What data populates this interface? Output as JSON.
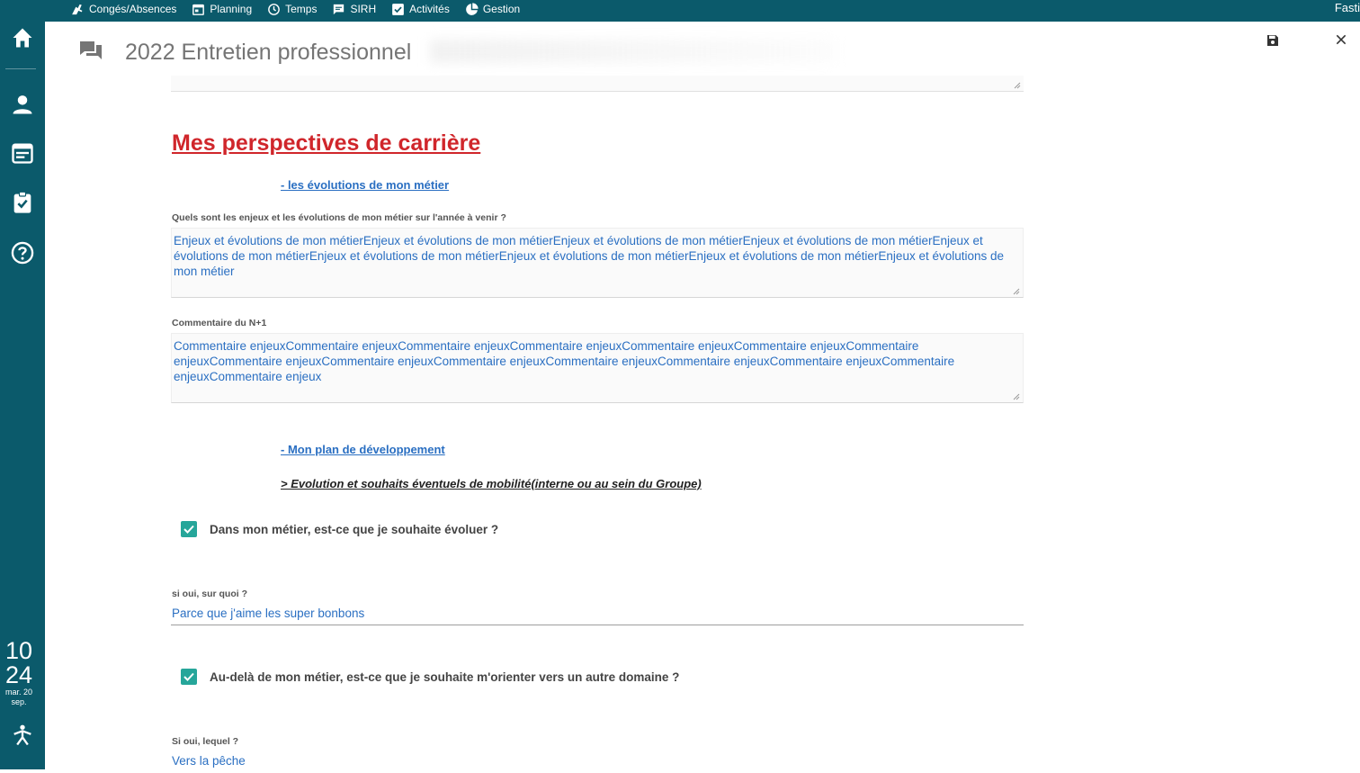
{
  "topnav": {
    "items": [
      {
        "label": "Congés/Absences",
        "icon": "plane-person-icon"
      },
      {
        "label": "Planning",
        "icon": "calendar-icon"
      },
      {
        "label": "Temps",
        "icon": "clock-icon"
      },
      {
        "label": "SIRH",
        "icon": "chat-icon"
      },
      {
        "label": "Activités",
        "icon": "checkbox-icon"
      },
      {
        "label": "Gestion",
        "icon": "pie-chart-icon"
      }
    ],
    "right_text": "Fasti"
  },
  "sidebar": {
    "icons": [
      "home-icon",
      "person-icon",
      "calendar-icon",
      "clipboard-check-icon",
      "help-icon",
      "figure-icon"
    ],
    "clock": {
      "hour": "10",
      "minute": "24",
      "date_line1": "mar. 20",
      "date_line2": "sep."
    }
  },
  "header": {
    "title": "2022 Entretien professionnel"
  },
  "content": {
    "section_title": "Mes perspectives de carrière",
    "link_evolutions": "- les évolutions de mon métier",
    "q_enjeux_label": "Quels sont les enjeux et les évolutions de mon métier sur l'année à venir ?",
    "q_enjeux_value": "Enjeux et évolutions de mon métierEnjeux et évolutions de mon métierEnjeux et évolutions de mon métierEnjeux et évolutions de mon métierEnjeux et évolutions de mon métierEnjeux et évolutions de mon métierEnjeux et évolutions de mon métierEnjeux et évolutions de mon métierEnjeux et évolutions de mon métier",
    "comment_label": "Commentaire du N+1",
    "comment_value": "Commentaire enjeuxCommentaire enjeuxCommentaire enjeuxCommentaire enjeuxCommentaire enjeuxCommentaire enjeuxCommentaire enjeuxCommentaire enjeuxCommentaire enjeuxCommentaire enjeuxCommentaire enjeuxCommentaire enjeuxCommentaire enjeuxCommentaire enjeuxCommentaire enjeux",
    "link_plan": "- Mon plan de développement",
    "mobility_title": "> Evolution et souhaits éventuels de mobilité(interne ou au sein du Groupe)",
    "check1_label": "Dans mon métier, est-ce que je souhaite évoluer ?",
    "check1_checked": true,
    "q_surquoi_label": "si oui, sur quoi ?",
    "q_surquoi_value": "Parce que j'aime les super bonbons",
    "check2_label": "Au-delà de mon métier, est-ce que je souhaite m'orienter vers un autre domaine ?",
    "check2_checked": true,
    "q_lequel_label": "Si oui, lequel ?",
    "q_lequel_value": "Vers la pêche"
  },
  "colors": {
    "brand": "#0b5a6b",
    "section_title": "#d0262b",
    "link": "#2a6fc2",
    "checkbox": "#26a69a"
  }
}
